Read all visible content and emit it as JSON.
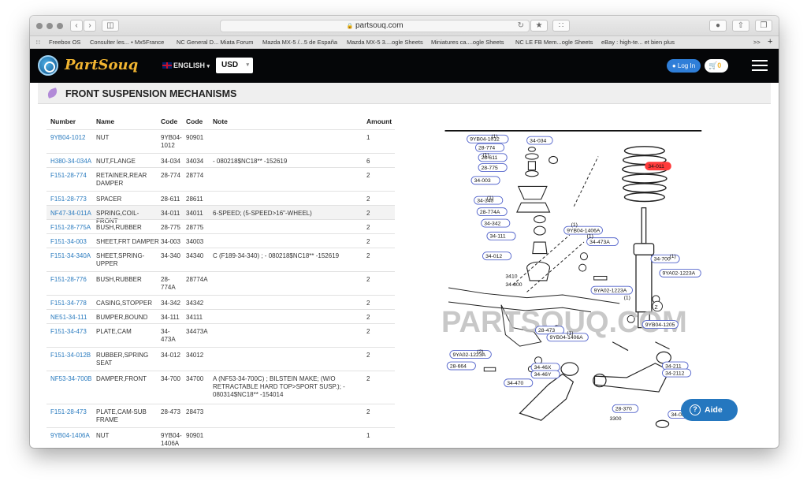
{
  "browser": {
    "url": "partsouq.com",
    "bookmarks": [
      "Freebox OS",
      "Consulter les... • Mx5France",
      "NC General D... Miata Forum",
      "Mazda MX-5 /...5 de España",
      "Mazda MX-5 3....ogle Sheets",
      "Miniatures ca....ogle Sheets",
      "NC LE FB Mem...ogle Sheets",
      "eBay : high-te... et bien plus"
    ],
    "more": ">>",
    "new_tab": "+"
  },
  "header": {
    "logo_text": "PartSouq",
    "language": "ENGLISH",
    "currency": "USD",
    "login_label": "Log In",
    "cart_count": "0"
  },
  "section": {
    "title": "FRONT SUSPENSION MECHANISMS"
  },
  "table": {
    "headers": {
      "number": "Number",
      "name": "Name",
      "code1": "Code",
      "code2": "Code",
      "note": "Note",
      "amount": "Amount"
    },
    "rows": [
      {
        "number": "9YB04-1012",
        "name": "NUT",
        "code1": "9YB04-1012",
        "code2": "90901",
        "note": "",
        "amount": "1"
      },
      {
        "number": "H380-34-034A",
        "name": "NUT,FLANGE",
        "code1": "34-034",
        "code2": "34034",
        "note": "- 080218$NC18** -152619",
        "amount": "6"
      },
      {
        "number": "F151-28-774",
        "name": "RETAINER,REAR DAMPER",
        "code1": "28-774",
        "code2": "28774",
        "note": "",
        "amount": "2"
      },
      {
        "number": "F151-28-773",
        "name": "SPACER",
        "code1": "28-611",
        "code2": "28611",
        "note": "",
        "amount": "2"
      },
      {
        "number": "NF47-34-011A",
        "name": "SPRING,COIL-FRONT",
        "code1": "34-011",
        "code2": "34011",
        "note": "6-SPEED; (5-SPEED>16\"-WHEEL)",
        "amount": "2"
      },
      {
        "number": "F151-28-775A",
        "name": "BUSH,RUBBER",
        "code1": "28-775",
        "code2": "28775",
        "note": "",
        "amount": "2"
      },
      {
        "number": "F151-34-003",
        "name": "SHEET,FRT DAMPER",
        "code1": "34-003",
        "code2": "34003",
        "note": "",
        "amount": "2"
      },
      {
        "number": "F151-34-340A",
        "name": "SHEET,SPRING-UPPER",
        "code1": "34-340",
        "code2": "34340",
        "note": "C (F189-34-340) ; - 080218$NC18** -152619",
        "amount": "2"
      },
      {
        "number": "F151-28-776",
        "name": "BUSH,RUBBER",
        "code1": "28-774A",
        "code2": "28774A",
        "note": "",
        "amount": "2"
      },
      {
        "number": "F151-34-778",
        "name": "CASING,STOPPER",
        "code1": "34-342",
        "code2": "34342",
        "note": "",
        "amount": "2"
      },
      {
        "number": "NE51-34-111",
        "name": "BUMPER,BOUND",
        "code1": "34-111",
        "code2": "34111",
        "note": "",
        "amount": "2"
      },
      {
        "number": "F151-34-473",
        "name": "PLATE,CAM",
        "code1": "34-473A",
        "code2": "34473A",
        "note": "",
        "amount": "2"
      },
      {
        "number": "F151-34-012B",
        "name": "RUBBER,SPRING SEAT",
        "code1": "34-012",
        "code2": "34012",
        "note": "",
        "amount": "2"
      },
      {
        "number": "NF53-34-700B",
        "name": "DAMPER,FRONT",
        "code1": "34-700",
        "code2": "34700",
        "note": "A (NF53-34-700C) ; BILSTEIN MAKE; (W/O RETRACTABLE HARD TOP>SPORT SUSP.); - 080314$NC18** -154014",
        "amount": "2"
      },
      {
        "number": "F151-28-473",
        "name": "PLATE,CAM-SUB FRAME",
        "code1": "28-473",
        "code2": "28473",
        "note": "",
        "amount": "2"
      },
      {
        "number": "9YB04-1406A",
        "name": "NUT",
        "code1": "9YB04-1406A",
        "code2": "90901",
        "note": "",
        "amount": "1"
      }
    ]
  },
  "diagram": {
    "watermark": "PARTSOUQ.COM",
    "callouts": [
      "9YB04-1012",
      "28-774",
      "28-611",
      "28-775",
      "34-034",
      "34-003",
      "34-340",
      "28-774A",
      "34-342",
      "34-111",
      "34-012",
      "34-011",
      "9YB04-1406A",
      "34-473A",
      "34-700",
      "9YA02-1223A",
      "9YA02-1223A",
      "9YB04-1205",
      "28-473",
      "9YB04-1406A",
      "9YA02-1223A",
      "28-664",
      "34-46X",
      "34-46Y",
      "34-470",
      "34-211",
      "34-2112",
      "28-370",
      "34-0A5",
      "3410",
      "34-800",
      "3300"
    ],
    "index_numbers": [
      "(1)",
      "(1)",
      "(1)",
      "(1)",
      "(1)",
      "(1)",
      "(1)",
      "(1)",
      "(2)"
    ],
    "view_label": "Z",
    "highlight_color": "#ff3b3b"
  },
  "help": {
    "label": "Aide",
    "icon": "?"
  }
}
